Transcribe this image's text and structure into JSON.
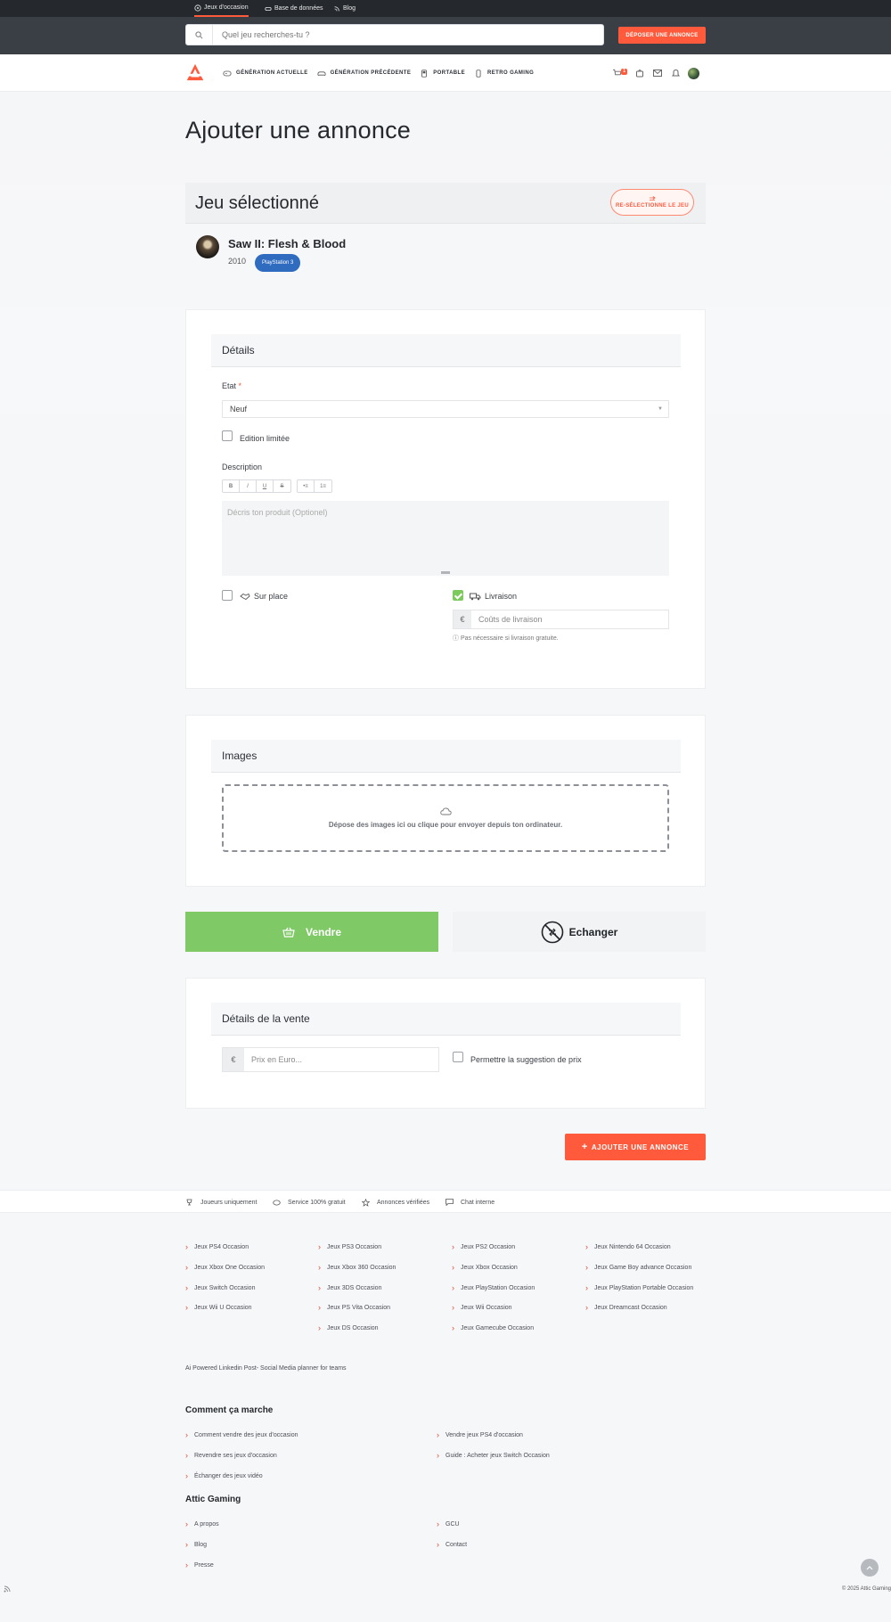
{
  "top_tabs": [
    {
      "label": "Jeux d'occasion"
    },
    {
      "label": "Base de données"
    },
    {
      "label": "Blog"
    }
  ],
  "search": {
    "placeholder": "Quel jeu recherches-tu ?"
  },
  "header": {
    "deposit_button": "DÉPOSER UNE ANNONCE",
    "cart_count": "1"
  },
  "nav": [
    {
      "label": "GÉNÉRATION ACTUELLE",
      "icon": "gamepad-icon"
    },
    {
      "label": "GÉNÉRATION PRÉCÉDENTE",
      "icon": "controller-icon"
    },
    {
      "label": "PORTABLE",
      "icon": "handheld-icon"
    },
    {
      "label": "RETRO GAMING",
      "icon": "retro-icon"
    }
  ],
  "page": {
    "title": "Ajouter une annonce"
  },
  "selected_game": {
    "heading": "Jeu sélectionné",
    "reselect_label": "RE-SÉLECTIONNE LE JEU",
    "title": "Saw II: Flesh & Blood",
    "year": "2010",
    "platform": "PlayStation 3"
  },
  "details": {
    "heading": "Détails",
    "state_label": "Etat",
    "state_required": "*",
    "state_value": "Neuf",
    "limited_edition_label": "Edition limitée",
    "description_label": "Description",
    "toolbar": [
      "B",
      "I",
      "U",
      "S",
      "•≡",
      "1≡"
    ],
    "description_placeholder": "Décris ton produit (Optionel)",
    "pickup_label": "Sur place",
    "pickup_checked": false,
    "delivery_label": "Livraison",
    "delivery_checked": true,
    "shipping_currency": "€",
    "shipping_placeholder": "Coûts de livraison",
    "shipping_hint": "Pas nécessaire si livraison gratuite."
  },
  "images": {
    "heading": "Images",
    "dropzone_text": "Dépose des images ici ou clique pour envoyer depuis ton ordinateur."
  },
  "mode": {
    "sell_label": "Vendre",
    "exchange_label": "Echanger",
    "active": "sell"
  },
  "sale": {
    "heading": "Détails de la vente",
    "currency": "€",
    "price_placeholder": "Prix en Euro...",
    "suggest_label": "Permettre la suggestion de prix"
  },
  "submit_label": "AJOUTER UNE ANNONCE",
  "features": [
    {
      "label": "Joueurs uniquement",
      "icon": "trophy-icon"
    },
    {
      "label": "Service 100% gratuit",
      "icon": "piggy-icon"
    },
    {
      "label": "Annonces vérifiées",
      "icon": "star-icon"
    },
    {
      "label": "Chat interne",
      "icon": "chat-icon"
    }
  ],
  "footer": {
    "columns": [
      [
        "Jeux PS4 Occasion",
        "Jeux Xbox One Occasion",
        "Jeux Switch Occasion",
        "Jeux Wii U Occasion"
      ],
      [
        "Jeux PS3 Occasion",
        "Jeux Xbox 360 Occasion",
        "Jeux 3DS Occasion",
        "Jeux PS Vita Occasion",
        "Jeux DS Occasion"
      ],
      [
        "Jeux PS2 Occasion",
        "Jeux Xbox Occasion",
        "Jeux PlayStation Occasion",
        "Jeux Wii Occasion",
        "Jeux Gamecube Occasion"
      ],
      [
        "Jeux Nintendo 64 Occasion",
        "Jeux Game Boy advance Occasion",
        "Jeux PlayStation Portable Occasion",
        "Jeux Dreamcast Occasion"
      ]
    ],
    "promo_text": "Ai Powered Linkedin Post- Social Media planner for teams",
    "how_heading": "Comment ça marche",
    "how_left": [
      "Comment vendre des jeux d'occasion",
      "Revendre ses jeux d'occasion",
      "Échanger des jeux vidéo"
    ],
    "how_right": [
      "Vendre jeux PS4 d'occasion",
      "Guide : Acheter jeux Switch Occasion"
    ],
    "attic_heading": "Attic Gaming",
    "attic_left": [
      "A propos",
      "Blog",
      "Presse"
    ],
    "attic_right": [
      "GCU",
      "Contact"
    ],
    "copyright": "© 2025 Attic Gaming"
  }
}
